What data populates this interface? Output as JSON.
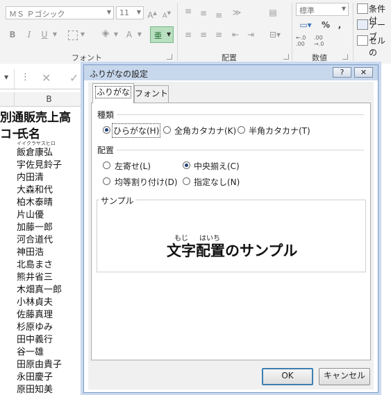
{
  "ribbon": {
    "font_name": "ＭＳ Ｐゴシック",
    "font_size": "11",
    "grow_font": "A",
    "shrink_font": "A",
    "bold": "B",
    "italic": "I",
    "underline": "U",
    "font_color": "A",
    "phonetic_btn": "亜",
    "font_group_label": "フォント",
    "align_group_label": "配置",
    "number_format": "標準",
    "percent": "%",
    "comma": ",",
    "dec_increase": "←.0 .00",
    "dec_decrease": ".00 →.0",
    "number_group_label": "数値",
    "styles": [
      "条件付",
      "テーブ",
      "セルの"
    ]
  },
  "sheet": {
    "namebox_arrow": "▼",
    "formula_dots": "⋮",
    "cancel_symbol": "✕",
    "enter_symbol": "✓",
    "column_b": "B",
    "title_cell": "別通販売上高",
    "header_a": "コー",
    "header_b": "氏名",
    "first_ruby": "イイクラヤスヒロ",
    "names": [
      "飯倉康弘",
      "宇佐見鈴子",
      "内田清",
      "大森和代",
      "柏木泰晴",
      "片山優",
      "加藤一郎",
      "河合道代",
      "神田浩",
      "北島まさ",
      "熊井省三",
      "木畑真一郎",
      "小林貞夫",
      "佐藤真理",
      "杉原ゆみ",
      "田中義行",
      "谷一雄",
      "田原由貴子",
      "永田慶子",
      "原田知美"
    ]
  },
  "dialog": {
    "title": "ふりがなの設定",
    "help": "?",
    "close": "✕",
    "tabs": [
      "ふりがな",
      "フォント"
    ],
    "type_section": "種類",
    "type_options": [
      "ひらがな(H)",
      "全角カタカナ(K)",
      "半角カタカナ(T)"
    ],
    "align_section": "配置",
    "align_options": [
      "左寄せ(L)",
      "中央揃え(C)",
      "均等割り付け(D)",
      "指定なし(N)"
    ],
    "sample_section": "サンプル",
    "sample_ruby_1": "もじ",
    "sample_ruby_2": "はいち",
    "sample_text": "文字配置のサンプル",
    "ok": "OK",
    "cancel": "キャンセル"
  }
}
